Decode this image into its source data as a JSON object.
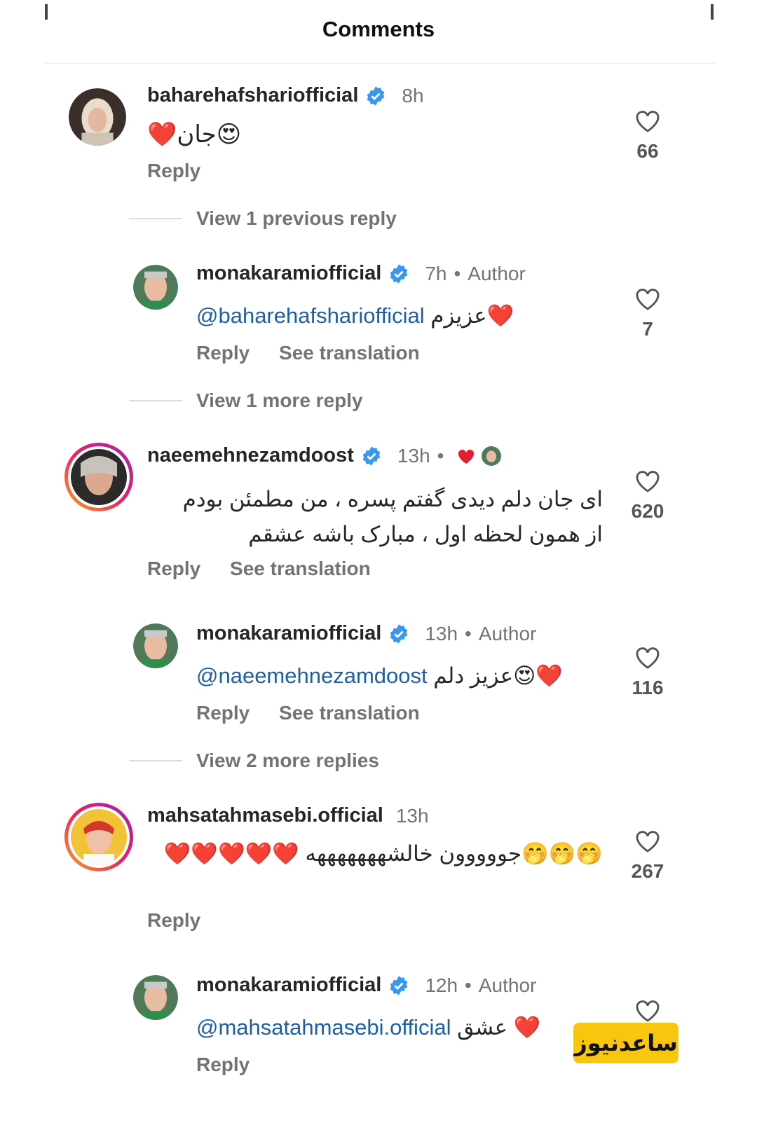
{
  "header": {
    "title": "Comments"
  },
  "threads": {
    "t1": "View 1 previous reply",
    "t2": "View 1 more reply",
    "t3": "View 2 more replies"
  },
  "comments": [
    {
      "username": "baharehafsharіofficial",
      "time": "8h",
      "text": "❤️جان😍",
      "actions": [
        "Reply"
      ],
      "likes": "66"
    },
    {
      "username": "monakaramiofficial",
      "time": "7h",
      "author": "Author",
      "mention": "@baharehafsharіofficial",
      "text": "عزیزم❤️",
      "actions": [
        "Reply",
        "See translation"
      ],
      "likes": "7"
    },
    {
      "username": "naeemehnezamdoost",
      "time": "13h",
      "text": "ای جان دلم دیدی گفتم پسره ، من مطمئن بودم از همون لحظه اول ، مبارک باشه عشقم",
      "actions": [
        "Reply",
        "See translation"
      ],
      "likes": "620"
    },
    {
      "username": "monakaramiofficial",
      "time": "13h",
      "author": "Author",
      "mention": "@naeemehnezamdoost",
      "text": "عزیز دلم😍❤️",
      "actions": [
        "Reply",
        "See translation"
      ],
      "likes": "116"
    },
    {
      "username": "mahsatahmasebi.official",
      "time": "13h",
      "text": "🤭🤭🤭جووووون خالشهههههههه ❤️❤️❤️❤️❤️",
      "text2": "",
      "actions": [
        "Reply"
      ],
      "likes": "267"
    },
    {
      "username": "monakaramiofficial",
      "time": "12h",
      "author": "Author",
      "mention": "@mahsatahmasebi.official",
      "text": "عشق ❤️",
      "actions": [
        "Reply"
      ],
      "likes": ""
    }
  ],
  "watermark": "ساعدنیوز",
  "colors": {
    "verified": "#3897f0",
    "mention": "#1c5fa8",
    "heart": "#e0202e",
    "watermark_bg": "#f8c60e"
  }
}
